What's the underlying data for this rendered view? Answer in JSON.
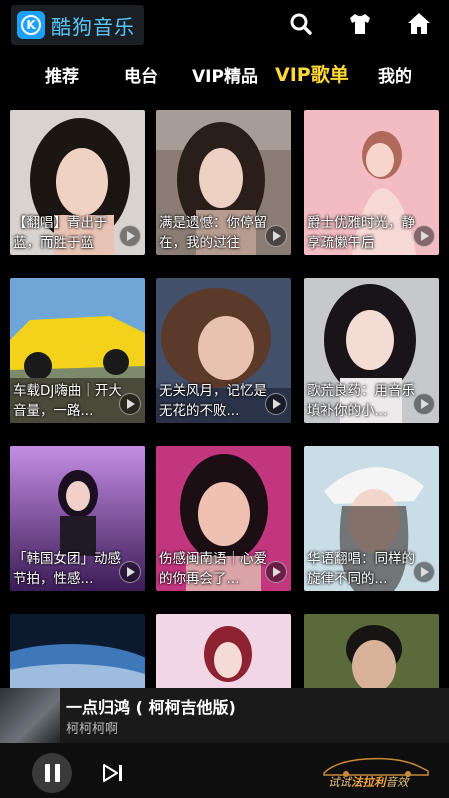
{
  "app": {
    "name": "酷狗音乐",
    "logo_letter": "K"
  },
  "header_icons": [
    "search-icon",
    "tshirt-icon",
    "home-icon"
  ],
  "tabs": [
    {
      "label": "推荐",
      "active": false
    },
    {
      "label": "电台",
      "active": false
    },
    {
      "label": "VIP精品",
      "active": false
    },
    {
      "label": "VIP歌单",
      "active": true
    },
    {
      "label": "我的",
      "active": false
    }
  ],
  "playlists": [
    {
      "caption": "【翻唱】青出于蓝，而胜于蓝"
    },
    {
      "caption": "满是遗憾：你停留在，我的过往"
    },
    {
      "caption": "爵士优雅时光，静享疏懒午后"
    },
    {
      "caption": "车载DJ嗨曲｜开大音量，一路..."
    },
    {
      "caption": "无关风月，记忆是无花的不败..."
    },
    {
      "caption": "歌荒良药：用音乐填补你的小..."
    },
    {
      "caption": "「韩国女团」动感节拍，性感..."
    },
    {
      "caption": "伤感闽南语｜心爱的你再会了..."
    },
    {
      "caption": "华语翻唱：同样的旋律不同的..."
    },
    {
      "caption": ""
    },
    {
      "caption": ""
    },
    {
      "caption": ""
    }
  ],
  "now_playing": {
    "title": "一点归鸿 ( 柯柯吉他版)",
    "artist": "柯柯柯啊"
  },
  "promo": {
    "prefix": "试试",
    "highlight": "法拉利",
    "suffix": "音效"
  },
  "colors": {
    "active_tab": "#ffd83a",
    "logo_blue": "#1da1ff"
  }
}
